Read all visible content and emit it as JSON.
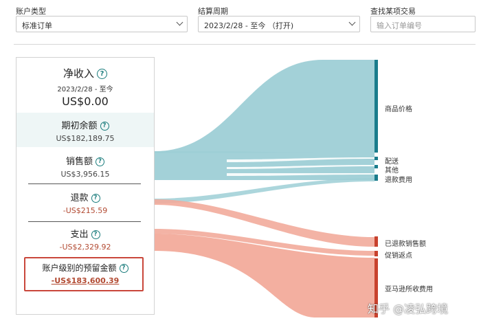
{
  "filters": {
    "account_type": {
      "label": "账户类型",
      "value": "标准订单"
    },
    "settlement_period": {
      "label": "结算周期",
      "value": "2023/2/28 - 至今 （打开)"
    },
    "find_transaction": {
      "label": "查找某项交易",
      "placeholder": "输入订单编号"
    }
  },
  "summary": {
    "net_income": {
      "title": "净收入",
      "date": "2023/2/28 - 至今",
      "amount": "US$0.00"
    },
    "opening_balance": {
      "title": "期初余额",
      "value": "US$182,189.75"
    },
    "sales": {
      "title": "销售额",
      "value": "US$3,956.15"
    },
    "refunds": {
      "title": "退款",
      "value": "-US$215.59"
    },
    "expenses": {
      "title": "支出",
      "value": "-US$2,329.92"
    },
    "reserve": {
      "title": "账户级别的预留金额",
      "value": "-US$183,600.39"
    }
  },
  "flow_labels": {
    "product_price": "商品价格",
    "shipping": "配送",
    "other": "其他",
    "refund_fee": "退款费用",
    "refunded_sales": "已退款销售额",
    "promo_rebate": "促销返点",
    "amazon_fees": "亚马逊所收费用"
  },
  "colors": {
    "teal_flow": "#9ecfd6",
    "teal_bar": "#1a7c8c",
    "red_flow": "#f2ab9b",
    "red_bar": "#c8422e",
    "highlight": "#c9463a"
  },
  "watermark": "知乎 @凌弘跨境"
}
